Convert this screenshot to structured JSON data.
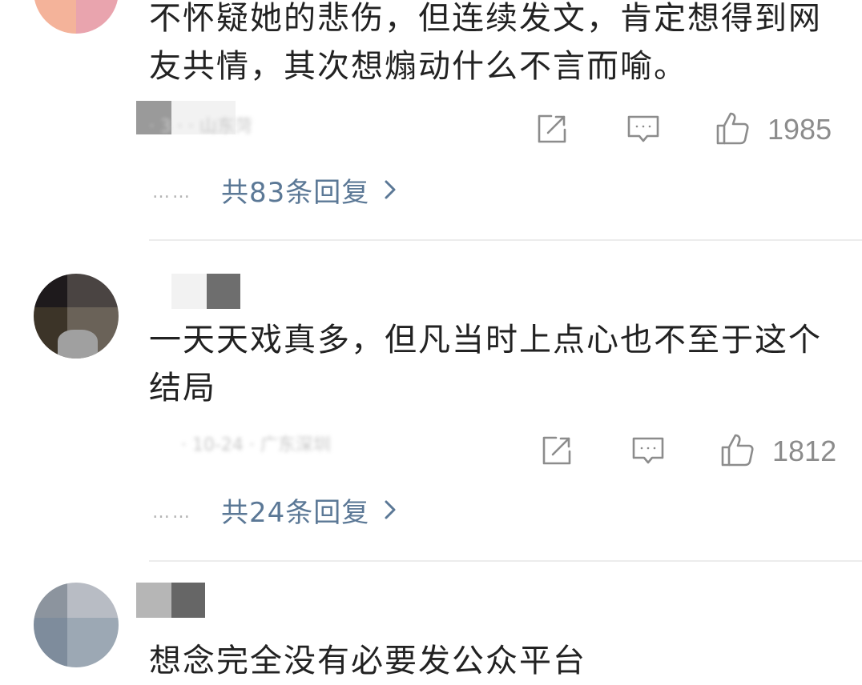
{
  "comments": [
    {
      "text": "不怀疑她的悲伤，但连续发文，肯定想得到网友共情，其次想煽动什么不言而喻。",
      "meta": "· 3  ·  ·  山东菏",
      "like_count": "1985",
      "reply_link": "共83条回复",
      "reply_dots": "……",
      "colors": {
        "avatar": [
          "#f4b39a",
          "#e9a4ae"
        ],
        "name": [
          "#9a9a9a",
          "#e2e2e2"
        ]
      }
    },
    {
      "text": "一天天戏真多，但凡当时上点心也不至于这个结局",
      "meta": "· 10-24 · 广东深圳",
      "like_count": "1812",
      "reply_link": "共24条回复",
      "reply_dots": "……",
      "colors": {
        "avatar": [
          "#1e1a1c",
          "#4a4442",
          "#3c3428",
          "#a0a0a0"
        ],
        "name": [
          "#f2f2f2",
          "#6e6e6e"
        ]
      }
    },
    {
      "text": "想念完全没有必要发公众平台",
      "colors": {
        "avatar": [
          "#8c949e",
          "#b8bcc4",
          "#7e8c9c",
          "#9ca8b4"
        ],
        "name": [
          "#b6b6b6",
          "#666666"
        ]
      }
    }
  ],
  "icons": {
    "share": "share-icon",
    "comment": "comment-icon",
    "like": "thumbs-up-icon",
    "chevron": "chevron-right-icon"
  },
  "theme": {
    "text_color": "#222222",
    "link_color": "#5b7896",
    "meta_color": "#8c8c8c",
    "divider_color": "#ececec"
  }
}
